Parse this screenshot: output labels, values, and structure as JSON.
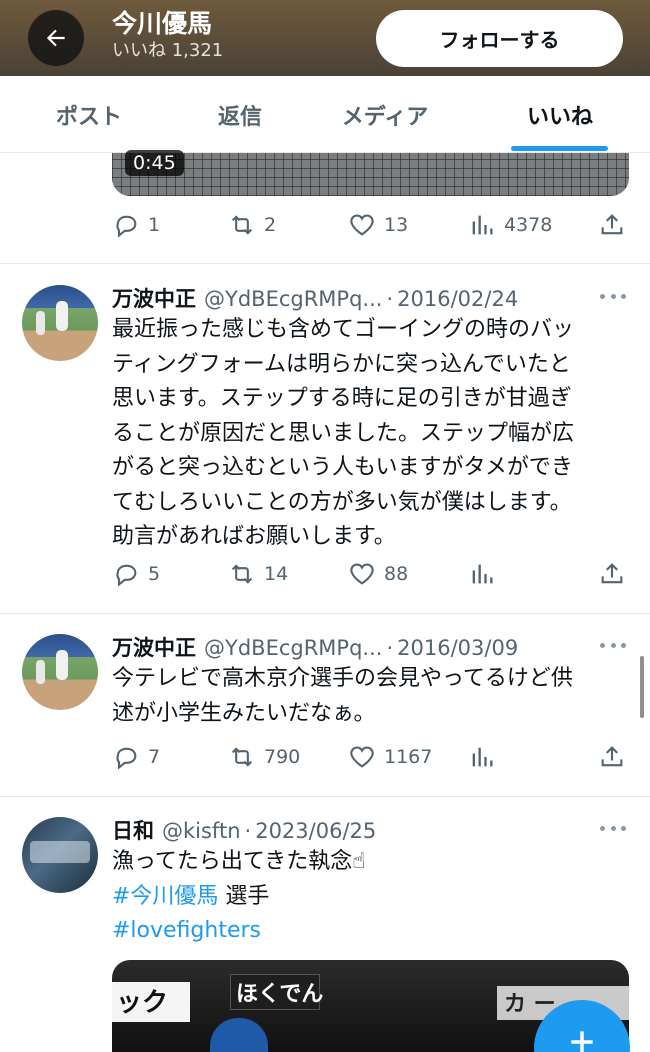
{
  "header": {
    "name": "今川優馬",
    "likes_label": "いいね 1,321",
    "follow_label": "フォローする"
  },
  "tabs": [
    {
      "label": "ポスト",
      "active": false
    },
    {
      "label": "返信",
      "active": false
    },
    {
      "label": "メディア",
      "active": false
    },
    {
      "label": "いいね",
      "active": true
    }
  ],
  "prev_tweet": {
    "video_time": "0:45",
    "replies": "1",
    "reposts": "2",
    "likes": "13",
    "views": "4378"
  },
  "tweets": [
    {
      "name": "万波中正",
      "handle": "@YdBEcgRMPq...",
      "date": "2016/02/24",
      "lines": [
        "最近振った感じも含めてゴーイングの時のバッ",
        "ティングフォームは明らかに突っ込んでいたと",
        "思います。ステップする時に足の引きが甘過ぎ",
        "ることが原因だと思いました。ステップ幅が広",
        "がると突っ込むという人もいますがタメができ",
        "てむしろいいことの方が多い気が僕はします。",
        "助言があればお願いします。"
      ],
      "replies": "5",
      "reposts": "14",
      "likes": "88"
    },
    {
      "name": "万波中正",
      "handle": "@YdBEcgRMPq...",
      "date": "2016/03/09",
      "lines": [
        "今テレビで高木京介選手の会見やってるけど供",
        "述が小学生みたいだなぁ。"
      ],
      "replies": "7",
      "reposts": "790",
      "likes": "1167"
    },
    {
      "name": "日和",
      "handle": "@kisftn",
      "date": "2023/06/25",
      "text": "漁ってたら出てきた執念☝",
      "hashtag1": "#今川優馬",
      "hashtag1_suffix": " 選手",
      "hashtag2": "#lovefighters"
    }
  ],
  "media_text": {
    "left": "ック",
    "center": "ほくでん",
    "right": "カ ー"
  },
  "colors": {
    "accent": "#1d9bf0",
    "text_secondary": "#536471"
  }
}
